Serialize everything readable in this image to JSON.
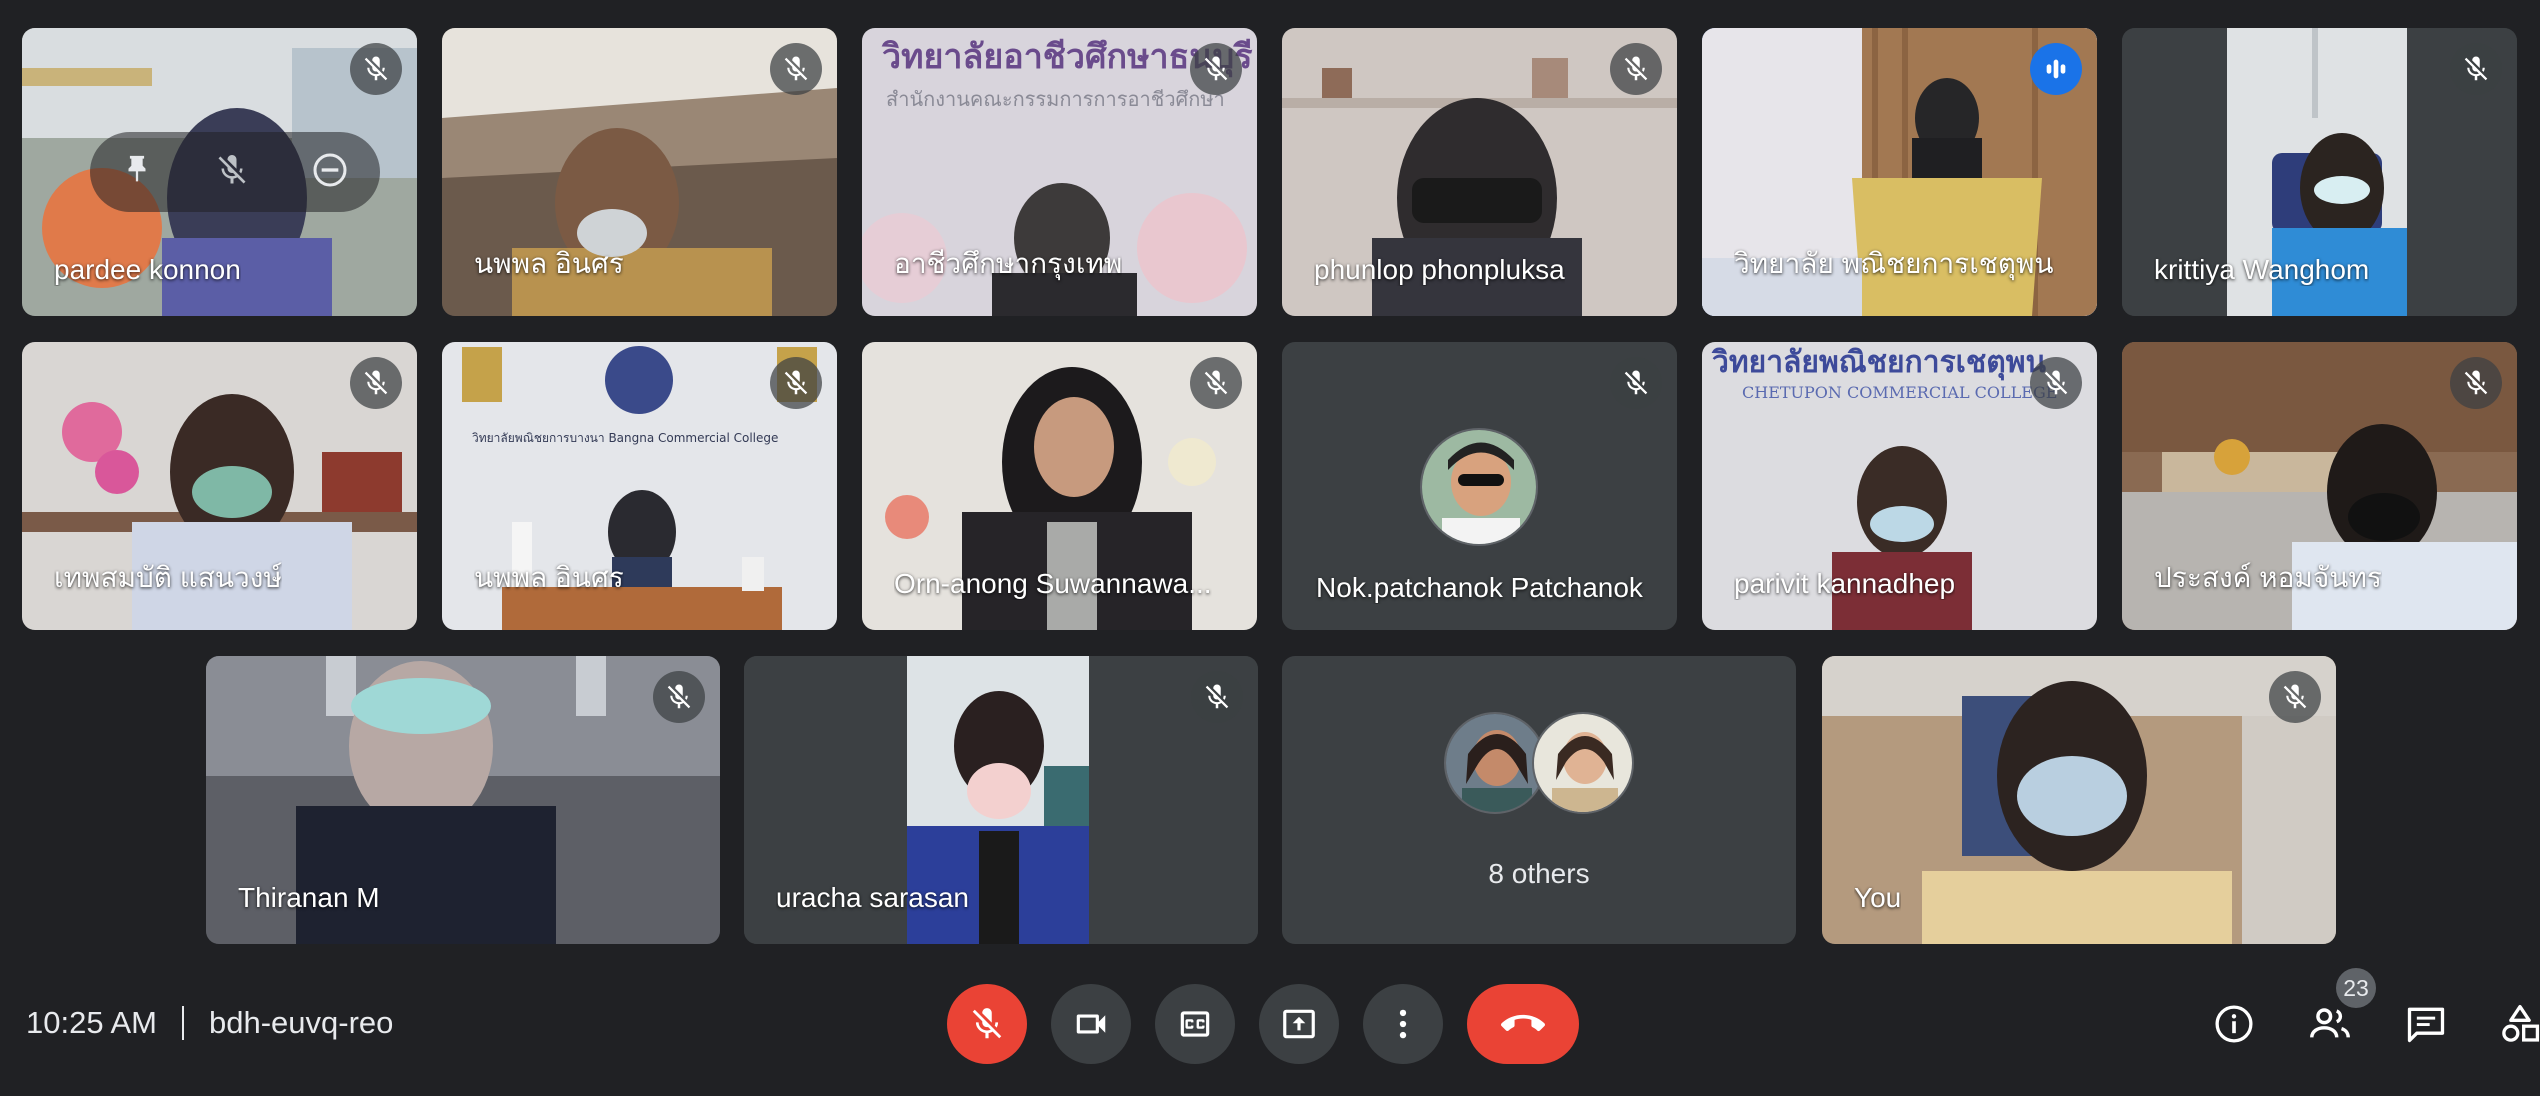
{
  "tiles_row1": [
    {
      "name": "pardee konnon",
      "mic": "muted"
    },
    {
      "name": "นพพล อินศร",
      "mic": "muted"
    },
    {
      "name": "อาชีวศึกษากรุงเทพ",
      "mic": "muted",
      "backdrop_text": "วิทยาลัยอาชีวศึกษาธนบุรี",
      "backdrop_subtext": "สำนักงานคณะกรรมการการอาชีวศึกษา"
    },
    {
      "name": "phunlop phonpluksa",
      "mic": "muted"
    },
    {
      "name": "วิทยาลัย พณิชยการเชตุพน",
      "mic": "speaking"
    },
    {
      "name": "krittiya Wanghom",
      "mic": "muted"
    }
  ],
  "tiles_row2": [
    {
      "name": "เทพสมบัติ แสนวงษ์",
      "mic": "muted"
    },
    {
      "name": "นพพล อินศร",
      "mic": "muted",
      "backdrop_text": "วิทยาลัยพณิชยการบางนา Bangna Commercial College"
    },
    {
      "name": "Orn-anong Suwannawa...",
      "mic": "muted"
    },
    {
      "name": "Nok.patchanok Patchanok",
      "mic": "muted"
    },
    {
      "name": "parivit kannadhep",
      "mic": "muted",
      "backdrop_text": "วิทยาลัยพณิชยการเชตุพน",
      "backdrop_subtext": "CHETUPON COMMERCIAL COLLEGE"
    },
    {
      "name": "ประสงค์ หอมจันทร",
      "mic": "muted"
    }
  ],
  "tiles_row3": [
    {
      "name": "Thiranan M",
      "mic": "muted"
    },
    {
      "name": "uracha sarasan",
      "mic": "muted"
    },
    {
      "name": "8 others"
    },
    {
      "name": "You",
      "mic": "muted"
    }
  ],
  "bottom": {
    "time": "10:25 AM",
    "meeting_code": "bdh-euvq-reo",
    "participant_count": "23"
  },
  "controls": [
    "mic-off-icon",
    "camera-icon",
    "captions-icon",
    "present-icon",
    "more-vert-icon",
    "end-call-icon"
  ],
  "tools": [
    "info-icon",
    "people-icon",
    "chat-icon",
    "activities-icon"
  ],
  "colors": {
    "background": "#202124",
    "tile": "#3c4043",
    "danger": "#ea4335",
    "accent": "#1a73e8",
    "active_outline": "#8ab4f8"
  }
}
